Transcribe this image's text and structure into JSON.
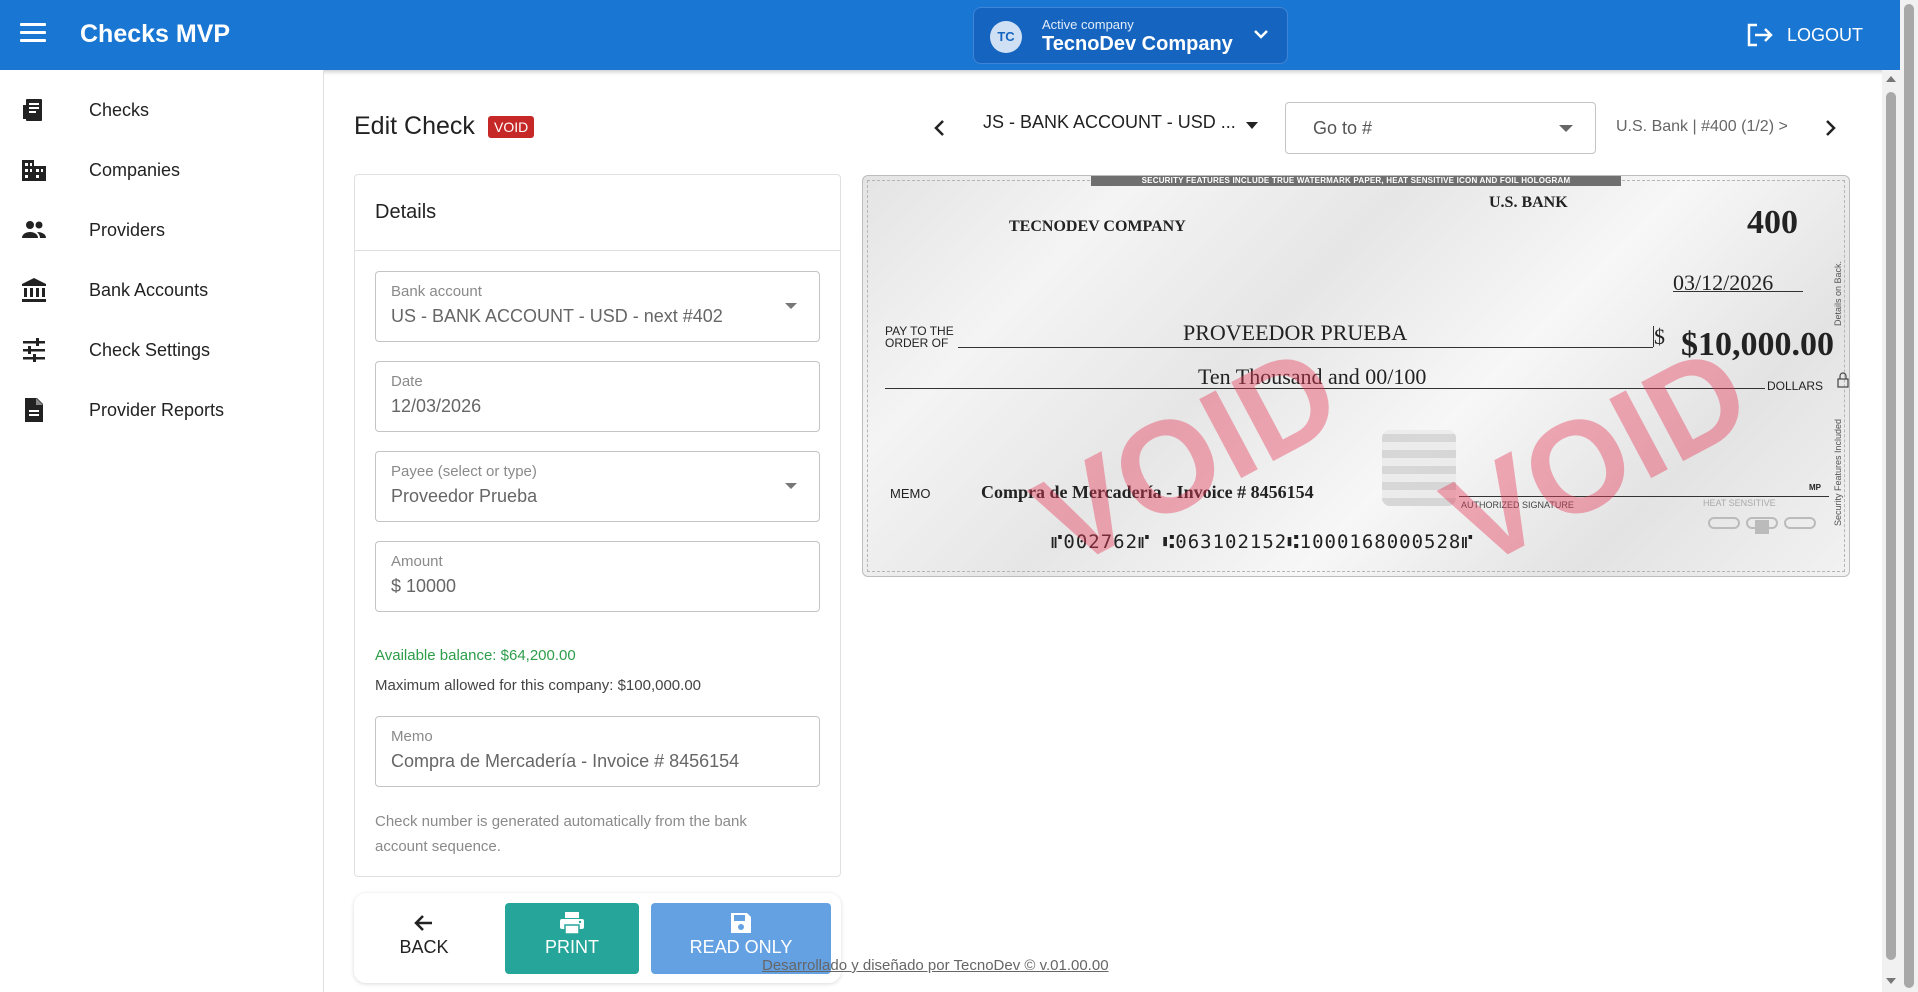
{
  "header": {
    "app_title": "Checks MVP",
    "company_label": "Active company",
    "company_initials": "TC",
    "company_name": "TecnoDev Company",
    "logout_label": "LOGOUT"
  },
  "sidebar": {
    "items": [
      {
        "label": "Checks",
        "icon": "checks-icon"
      },
      {
        "label": "Companies",
        "icon": "building-icon"
      },
      {
        "label": "Providers",
        "icon": "people-icon"
      },
      {
        "label": "Bank Accounts",
        "icon": "bank-icon"
      },
      {
        "label": "Check Settings",
        "icon": "tune-icon"
      },
      {
        "label": "Provider Reports",
        "icon": "report-icon"
      }
    ]
  },
  "page": {
    "title": "Edit Check",
    "status_badge": "VOID",
    "account_select": "JS - BANK ACCOUNT - USD ...",
    "goto_placeholder": "Go to #",
    "pager_text": "U.S. Bank | #400 (1/2) >"
  },
  "details": {
    "heading": "Details",
    "bank_account": {
      "label": "Bank account",
      "value": "US - BANK ACCOUNT - USD - next #402"
    },
    "date": {
      "label": "Date",
      "value": "12/03/2026"
    },
    "payee": {
      "label": "Payee (select or type)",
      "value": "Proveedor Prueba"
    },
    "amount": {
      "label": "Amount",
      "value": "$ 10000"
    },
    "available_balance": "Available balance: $64,200.00",
    "max_allowed": "Maximum allowed for this company: $100,000.00",
    "memo": {
      "label": "Memo",
      "value": "Compra de Mercadería - Invoice # 8456154"
    },
    "helper": "Check number is generated automatically from the bank account sequence."
  },
  "actions": {
    "back": "BACK",
    "print": "PRINT",
    "read_only": "READ ONLY"
  },
  "check": {
    "security_band": "SECURITY FEATURES INCLUDE TRUE WATERMARK PAPER, HEAT SENSITIVE ICON AND FOIL HOLOGRAM",
    "bank_name": "U.S. BANK",
    "company": "TECNODEV COMPANY",
    "number": "400",
    "date": "03/12/2026",
    "pay_to_line1": "PAY TO THE",
    "pay_to_line2": "ORDER OF",
    "payee": "PROVEEDOR PRUEBA",
    "dollar_sign": "$",
    "amount": "$10,000.00",
    "amount_words": "Ten Thousand and 00/100",
    "dollars_label": "DOLLARS",
    "memo_label": "MEMO",
    "memo": "Compra de Mercadería - Invoice # 8456154",
    "signature_label": "AUTHORIZED SIGNATURE",
    "mp_label": "MP",
    "heat_label": "HEAT SENSITIVE",
    "micr": "⑈002762⑈ ⑆063102152⑆1000168000528⑈",
    "side_text_top": "Details on Back.",
    "side_text_bottom": "Security Features Included",
    "void_watermark": "VOID"
  },
  "footer": {
    "credit": "Desarrollado y diseñado por TecnoDev © v.01.00.00"
  },
  "colors": {
    "primary": "#1976d2",
    "print_button": "#26a69a",
    "readonly_button": "#64a1e3",
    "void_badge": "#c62828",
    "balance_text": "#2e9d4a"
  }
}
